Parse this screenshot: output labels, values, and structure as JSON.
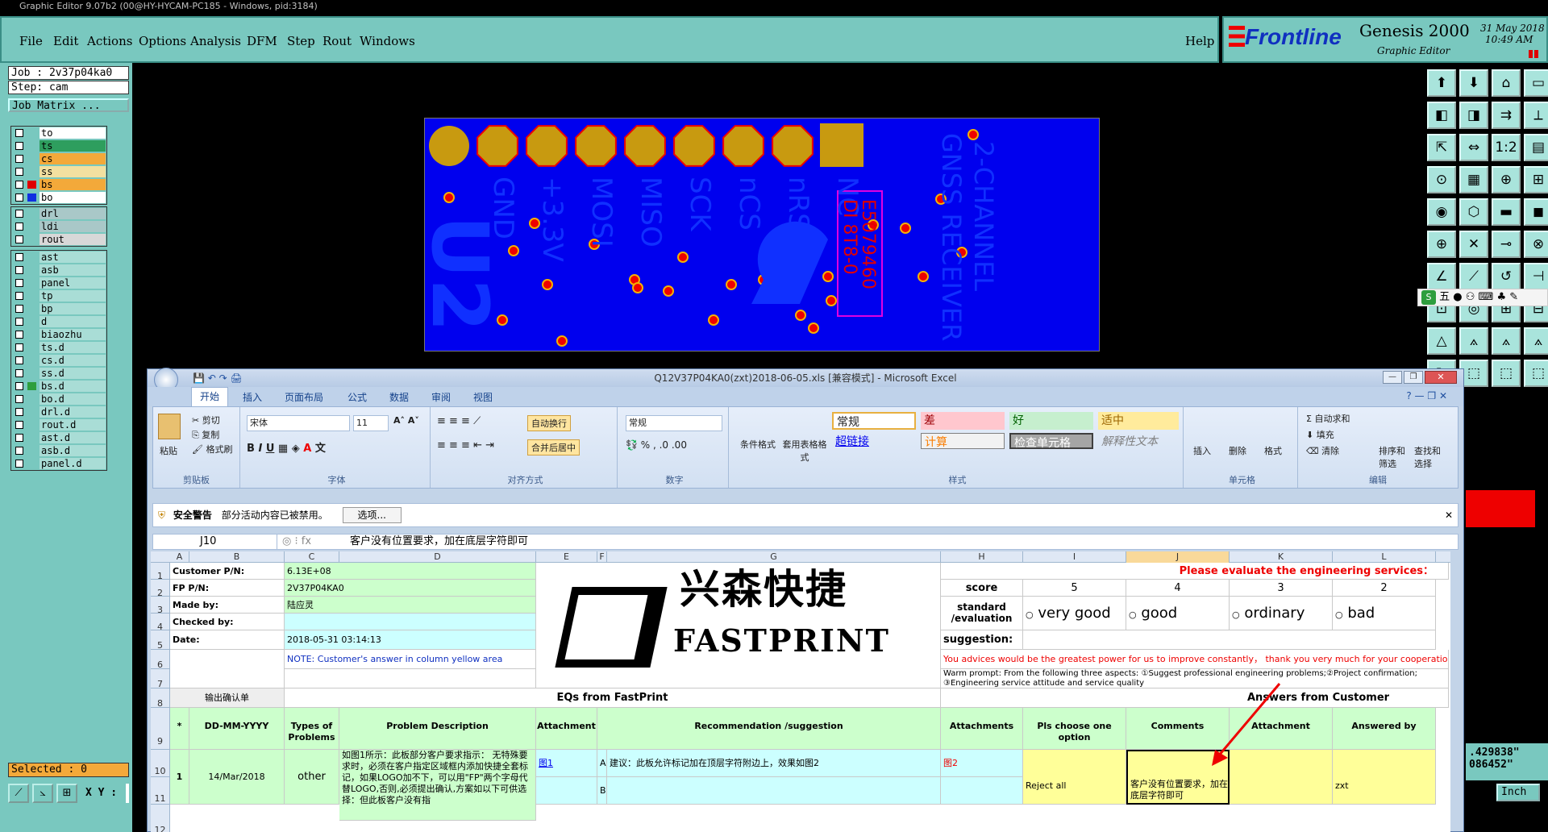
{
  "genesis": {
    "title": "Graphic Editor 9.07b2 (00@HY-HYCAM-PC185 - Windows, pid:3184)",
    "menu": [
      "File",
      "Edit",
      "Actions",
      "Options",
      "Analysis",
      "DFM",
      "Step",
      "Rout",
      "Windows"
    ],
    "help": "Help",
    "brand": "Frontline",
    "product": "Genesis 2000",
    "subtitle": "Graphic Editor",
    "date": "31 May 2018",
    "time": "10:49 AM",
    "job": "Job : 2v37p04ka0",
    "step": "Step: cam",
    "job_matrix": "Job Matrix ...",
    "layers_group1": [
      {
        "name": "to",
        "color": "#ffffff",
        "swatch": ""
      },
      {
        "name": "ts",
        "color": "#2e9e5e",
        "swatch": ""
      },
      {
        "name": "cs",
        "color": "#f3a93a",
        "swatch": ""
      },
      {
        "name": "ss",
        "color": "#f3e0a0",
        "swatch": ""
      },
      {
        "name": "bs",
        "color": "#f3a93a",
        "swatch": "#e00000"
      },
      {
        "name": "bo",
        "color": "#ffffff",
        "swatch": "#1030e0"
      }
    ],
    "layers_group2": [
      {
        "name": "drl",
        "color": "#a9c8c8",
        "swatch": ""
      },
      {
        "name": "ldi",
        "color": "#a9c8c8",
        "swatch": ""
      },
      {
        "name": "rout",
        "color": "#d8d8d8",
        "swatch": ""
      }
    ],
    "layers_group3": [
      {
        "name": "ast",
        "swatch": ""
      },
      {
        "name": "asb",
        "swatch": ""
      },
      {
        "name": "panel",
        "swatch": ""
      },
      {
        "name": "tp",
        "swatch": ""
      },
      {
        "name": "bp",
        "swatch": ""
      },
      {
        "name": "d",
        "swatch": ""
      },
      {
        "name": "biaozhu",
        "swatch": ""
      },
      {
        "name": "ts.d",
        "swatch": ""
      },
      {
        "name": "cs.d",
        "swatch": ""
      },
      {
        "name": "ss.d",
        "swatch": ""
      },
      {
        "name": "bs.d",
        "swatch": "#2e9e3e"
      },
      {
        "name": "bo.d",
        "swatch": ""
      },
      {
        "name": "drl.d",
        "swatch": ""
      },
      {
        "name": "rout.d",
        "swatch": ""
      },
      {
        "name": "ast.d",
        "swatch": ""
      },
      {
        "name": "asb.d",
        "swatch": ""
      },
      {
        "name": "panel.d",
        "swatch": ""
      }
    ],
    "selected": "Selected : 0",
    "xy_label": "X Y :",
    "coord1": ".429838\"",
    "coord2": "086452\"",
    "units": "Inch",
    "pcb_labels": [
      "GND",
      "+3.3V",
      "MOSI",
      "MISO",
      "SCK",
      "nCS",
      "nRST",
      "NC"
    ],
    "pcb_text1": "GNSS RECEIVER",
    "pcb_text2": "2-CHANNEL",
    "pcb_text3": "DI 8T8-0",
    "pcb_text4": "E5079460",
    "pcb_big": "U2"
  },
  "excel": {
    "title": "Q12V37P04KA0(zxt)2018-06-05.xls [兼容模式] - Microsoft Excel",
    "tabs": [
      "开始",
      "插入",
      "页面布局",
      "公式",
      "数据",
      "审阅",
      "视图"
    ],
    "clipboard": {
      "paste": "粘贴",
      "cut": "剪切",
      "copy": "复制",
      "format_painter": "格式刷",
      "label": "剪贴板"
    },
    "font": {
      "name": "宋体",
      "size": "11",
      "label": "字体"
    },
    "align": {
      "wrap": "自动换行",
      "merge": "合并后居中",
      "label": "对齐方式"
    },
    "number": {
      "format": "常规",
      "label": "数字"
    },
    "styles": {
      "cond": "条件格式",
      "table": "套用表格格式",
      "normal": "常规",
      "bad": "差",
      "good": "好",
      "neutral": "适中",
      "hyperlink": "超链接",
      "calc": "计算",
      "check": "检查单元格",
      "explain": "解释性文本",
      "label": "样式"
    },
    "cells": {
      "insert": "插入",
      "delete": "删除",
      "format": "格式",
      "label": "单元格"
    },
    "edit": {
      "autosum": "自动求和",
      "fill": "填充",
      "clear": "清除",
      "sort": "排序和筛选",
      "find": "查找和选择",
      "label": "编辑"
    },
    "security": {
      "title": "安全警告",
      "msg": "部分活动内容已被禁用。",
      "options": "选项..."
    },
    "namebox": "J10",
    "formula": "客户没有位置要求，加在底层字符即可",
    "columns": [
      "A",
      "B",
      "C",
      "D",
      "E",
      "F",
      "G",
      "H",
      "I",
      "J",
      "K",
      "L"
    ],
    "rows": {
      "r1": {
        "label": "Customer P/N:",
        "value": "6.13E+08"
      },
      "r2": {
        "label": "FP P/N:",
        "value": "2V37P04KA0"
      },
      "r3": {
        "label": "Made by:",
        "value": "陆应灵"
      },
      "r4": {
        "label": "Checked by:",
        "value": ""
      },
      "r5": {
        "label": "Date:",
        "value": "2018-05-31 03:14:13"
      },
      "r6": {
        "note": "NOTE: Customer's answer in column yellow area"
      },
      "r8": {
        "confirm": "输出确认单",
        "eqs": "EQs from FastPrint",
        "answers": "Answers from Customer"
      },
      "r9": [
        "*",
        "DD-MM-YYYY",
        "Types of Problems",
        "Problem Description",
        "Attachment",
        "Recommendation /suggestion",
        "Attachments",
        "Pls choose one option",
        "Comments",
        "Attachment",
        "Answered by"
      ],
      "r10": {
        "no": "1",
        "date": "14/Mar/2018",
        "type": "other",
        "desc": "如图1所示：此板部分客户要求指示：  无特殊要求时，必须在客户指定区域框内添加快捷全套标记，如果LOGO加不下，可以用\"FP\"两个字母代替LOGO,否则,必须提出确认,方案如以下可供选择：但此板客户没有指",
        "att": "图1",
        "e1": "A",
        "rec": "建议：此板允许标记加在顶层字符附边上，效果如图2",
        "att2": "图2",
        "e2": "B",
        "choice": "Reject all",
        "comment": "客户没有位置要求，加在底层字符即可",
        "by": "zxt"
      }
    },
    "logo_cn": "兴森快捷",
    "logo_en": "FASTPRINT",
    "eval": {
      "heading": "Please evaluate the engineering services：",
      "score": "score",
      "s5": "5",
      "s4": "4",
      "s3": "3",
      "s2": "2",
      "standard": "standard /evaluation",
      "very_good": "very good",
      "good": "good",
      "ordinary": "ordinary",
      "bad": "bad",
      "suggestion": "suggestion:",
      "advice": "You advices would be the greatest power for us to improve constantly， thank you very much for your cooperation!",
      "warm": "Warm prompt: From the following three aspects: ①Suggest professional engineering problems;②Project confirmation;",
      "warm2": "③Engineering service attitude and service quality"
    }
  },
  "ime": {
    "label": "五"
  }
}
